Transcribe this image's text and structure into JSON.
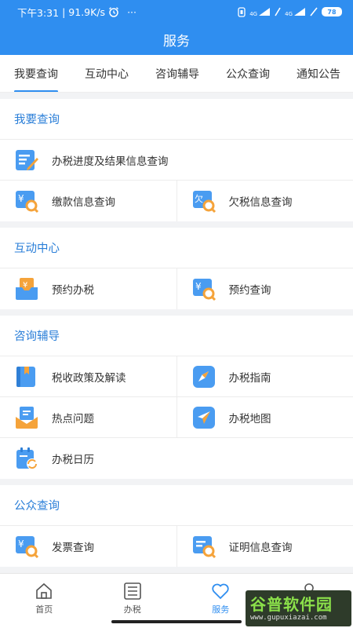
{
  "status_bar": {
    "time": "下午3:31",
    "network_speed": "91.9K/s",
    "more": "···",
    "signal_label_1": "4G",
    "signal_label_2": "4G",
    "battery": "78"
  },
  "header": {
    "title": "服务"
  },
  "tabs": [
    {
      "label": "我要查询",
      "active": true
    },
    {
      "label": "互动中心",
      "active": false
    },
    {
      "label": "咨询辅导",
      "active": false
    },
    {
      "label": "公众查询",
      "active": false
    },
    {
      "label": "通知公告",
      "active": false
    }
  ],
  "sections": {
    "query": {
      "title": "我要查询",
      "items": [
        "办税进度及结果信息查询",
        "缴款信息查询",
        "欠税信息查询"
      ]
    },
    "interact": {
      "title": "互动中心",
      "items": [
        "预约办税",
        "预约查询"
      ]
    },
    "consult": {
      "title": "咨询辅导",
      "items": [
        "税收政策及解读",
        "办税指南",
        "热点问题",
        "办税地图",
        "办税日历"
      ]
    },
    "public": {
      "title": "公众查询",
      "items": [
        "发票查询",
        "证明信息查询"
      ]
    }
  },
  "icons": {
    "yen_glyph": "¥",
    "owe_glyph": "欠"
  },
  "bottom_nav": [
    {
      "label": "首页",
      "icon": "home-icon",
      "active": false
    },
    {
      "label": "办税",
      "icon": "list-icon",
      "active": false
    },
    {
      "label": "服务",
      "icon": "heart-icon",
      "active": true
    },
    {
      "label": "",
      "icon": "person-icon",
      "active": false
    }
  ],
  "watermark": {
    "brand": "谷普软件园",
    "url": "www.gupuxiazai.com"
  },
  "colors": {
    "primary": "#2f8ef0",
    "section_title": "#2b7fd8",
    "icon_orange": "#f5a33a"
  }
}
